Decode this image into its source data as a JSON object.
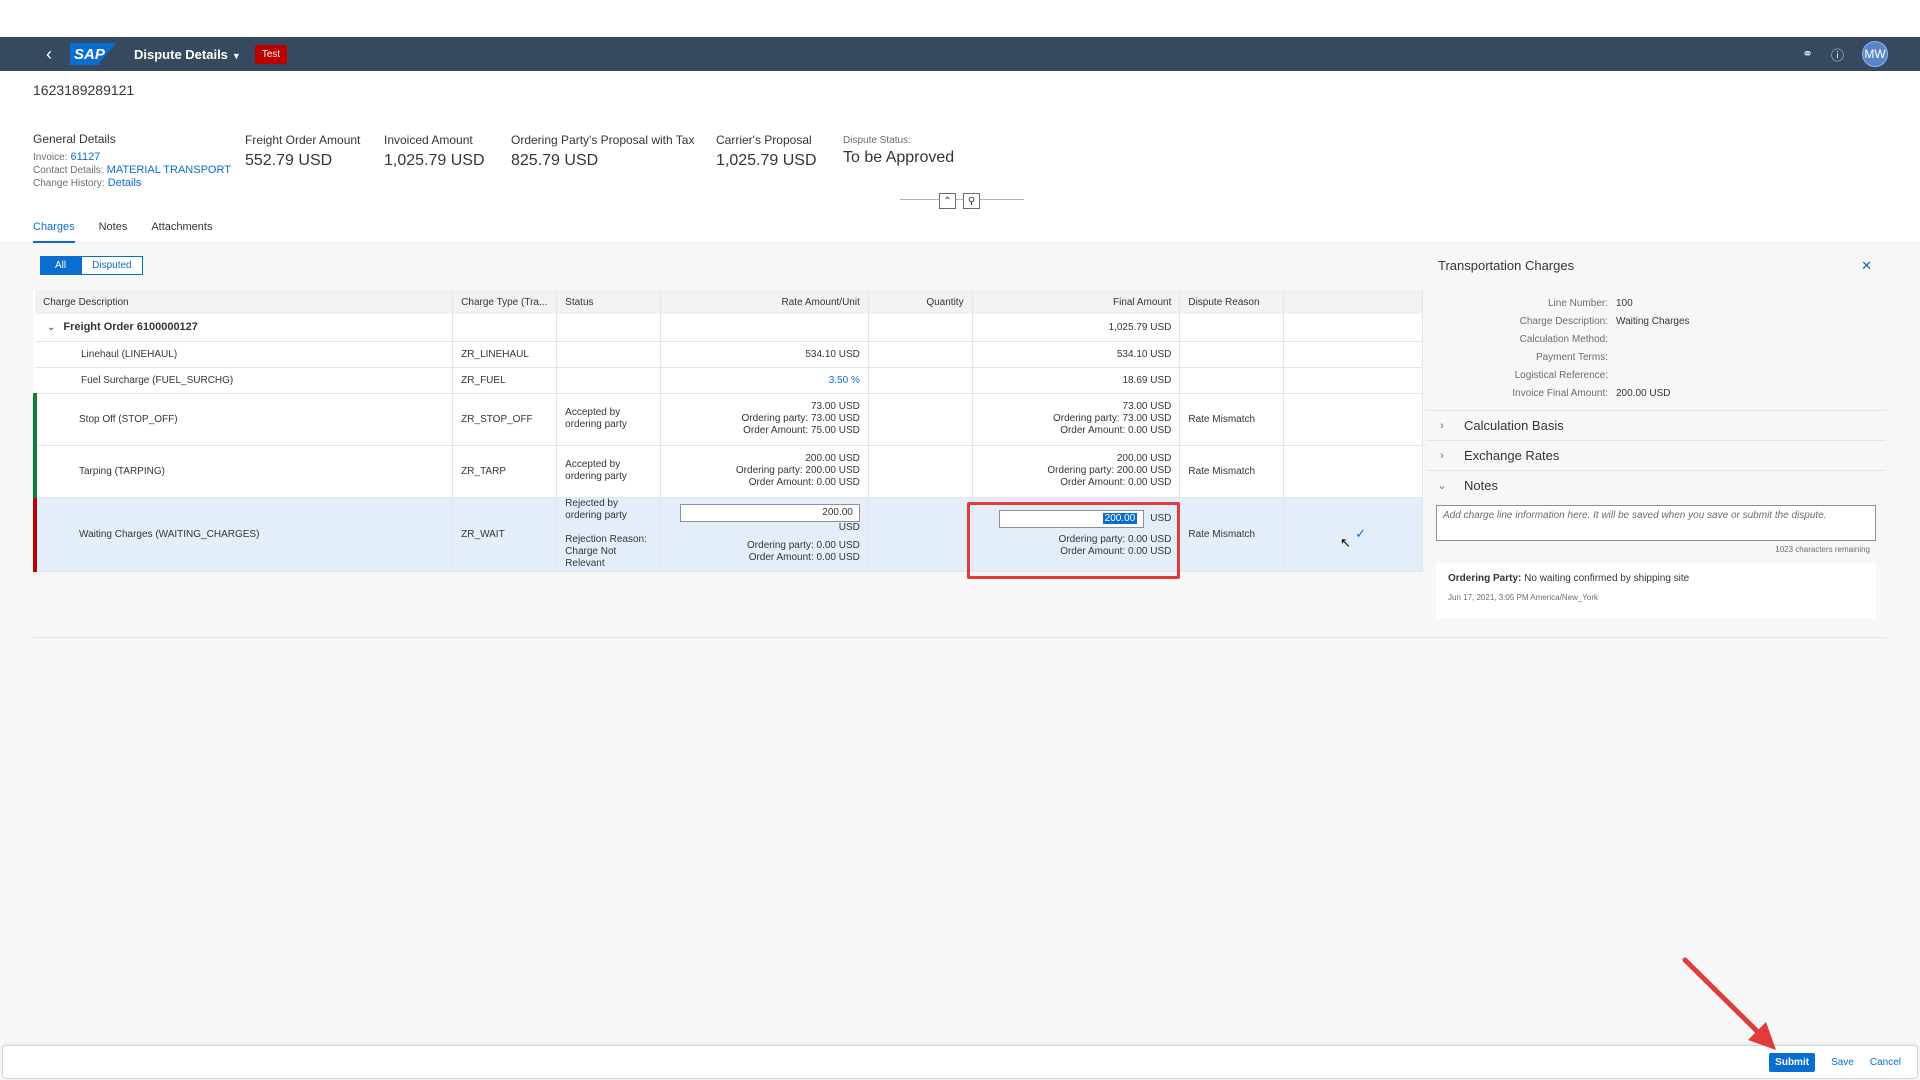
{
  "shell": {
    "title": "Dispute Details",
    "badge": "Test",
    "logo": "SAP",
    "avatar": "MW"
  },
  "header": {
    "object_id": "1623189289121",
    "general": {
      "title": "General Details",
      "invoice_label": "Invoice:",
      "invoice_value": "61127",
      "contact_label": "Contact Details:",
      "contact_value": "MATERIAL TRANSPORT",
      "history_label": "Change History:",
      "history_value": "Details"
    },
    "kpis": [
      {
        "label": "Freight Order Amount",
        "value": "552.79 USD"
      },
      {
        "label": "Invoiced Amount",
        "value": "1,025.79 USD"
      },
      {
        "label": "Ordering Party's Proposal with Tax",
        "value": "825.79 USD"
      },
      {
        "label": "Carrier's Proposal",
        "value": "1,025.79 USD"
      }
    ],
    "status_label": "Dispute Status:",
    "status_value": "To be Approved"
  },
  "tabs": [
    "Charges",
    "Notes",
    "Attachments"
  ],
  "filter": {
    "all": "All",
    "disputed": "Disputed"
  },
  "table": {
    "columns": [
      "Charge Description",
      "Charge Type (Tra...",
      "Status",
      "Rate Amount/Unit",
      "Quantity",
      "Final Amount",
      "Dispute Reason"
    ],
    "group": {
      "label": "Freight Order 6100000127",
      "final": "1,025.79 USD"
    },
    "rows": [
      {
        "desc": "Linehaul (LINEHAUL)",
        "type": "ZR_LINEHAUL",
        "rate": "534.10 USD",
        "final": "534.10 USD"
      },
      {
        "desc": "Fuel Surcharge (FUEL_SURCHG)",
        "type": "ZR_FUEL",
        "rate": "3.50 %",
        "final": "18.69 USD"
      },
      {
        "desc": "Stop Off (STOP_OFF)",
        "type": "ZR_STOP_OFF",
        "status": "Accepted by ordering party",
        "rate1": "73.00 USD",
        "rate2": "Ordering party: 73.00 USD",
        "rate3": "Order Amount: 75.00 USD",
        "final1": "73.00 USD",
        "final2": "Ordering party: 73.00 USD",
        "final3": "Order Amount: 0.00 USD",
        "reason": "Rate Mismatch"
      },
      {
        "desc": "Tarping (TARPING)",
        "type": "ZR_TARP",
        "status": "Accepted by ordering party",
        "rate1": "200.00 USD",
        "rate2": "Ordering party: 200.00 USD",
        "rate3": "Order Amount: 0.00 USD",
        "final1": "200.00 USD",
        "final2": "Ordering party: 200.00 USD",
        "final3": "Order Amount: 0.00 USD",
        "reason": "Rate Mismatch"
      },
      {
        "desc": "Waiting Charges (WAITING_CHARGES)",
        "type": "ZR_WAIT",
        "status1": "Rejected by ordering party",
        "status2": "Rejection Reason: Charge Not Relevant",
        "rate_input": "200.00",
        "rate_unit": "USD",
        "rate2": "Ordering party: 0.00 USD",
        "rate3": "Order Amount: 0.00 USD",
        "final_input": "200.00",
        "final_unit": "USD",
        "final2": "Ordering party: 0.00 USD",
        "final3": "Order Amount: 0.00 USD",
        "reason": "Rate Mismatch"
      }
    ]
  },
  "side_panel": {
    "title": "Transportation Charges",
    "fields": [
      {
        "label": "Line Number:",
        "value": "100"
      },
      {
        "label": "Charge Description:",
        "value": "Waiting Charges"
      },
      {
        "label": "Calculation Method:",
        "value": ""
      },
      {
        "label": "Payment Terms:",
        "value": ""
      },
      {
        "label": "Logistical Reference:",
        "value": ""
      },
      {
        "label": "Invoice Final Amount:",
        "value": "200.00 USD"
      }
    ],
    "sections": [
      "Calculation Basis",
      "Exchange Rates",
      "Notes"
    ],
    "notes_placeholder": "Add charge line information here. It will be saved when you save or submit the dispute.",
    "chars_remaining": "1023 characters remaining",
    "note": {
      "author": "Ordering Party:",
      "text": "No waiting confirmed by shipping site",
      "timestamp": "Jun 17, 2021, 3:05 PM America/New_York"
    }
  },
  "footer": {
    "submit": "Submit",
    "save": "Save",
    "cancel": "Cancel"
  },
  "colors": {
    "shell": "#354a5f",
    "accent": "#0a6ed1",
    "success": "#107e3e",
    "error": "#bb0000",
    "annotation": "#e03c3c"
  },
  "icons": [
    "back-icon",
    "share-icon",
    "help-icon",
    "close-icon",
    "chevron-right-icon",
    "chevron-down-icon",
    "check-icon",
    "collapse-icon",
    "pin-icon"
  ]
}
